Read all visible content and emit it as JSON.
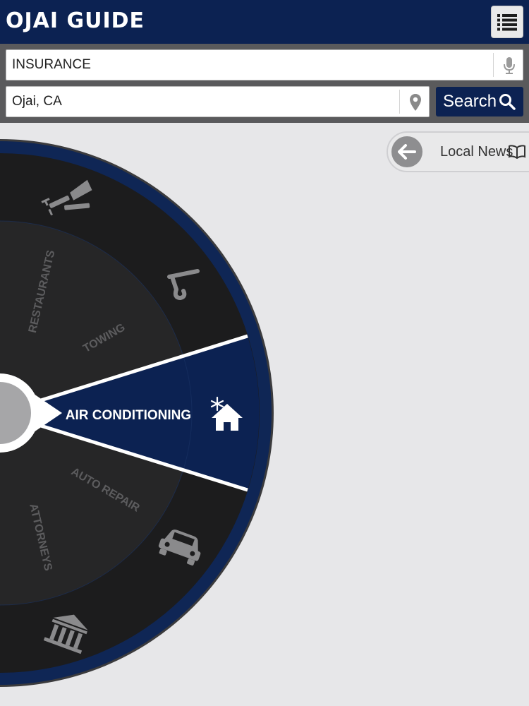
{
  "header": {
    "title": "OJAI GUIDE",
    "menu_icon": "list-icon"
  },
  "search": {
    "keyword_value": "INSURANCE",
    "location_value": "Ojai, CA",
    "button_label": "Search"
  },
  "news": {
    "label": "Local News"
  },
  "wheel": {
    "selected": "AIR CONDITIONING",
    "categories": [
      "RESTAURANTS",
      "TOWING",
      "AUTO REPAIR",
      "ATTORNEYS"
    ]
  },
  "colors": {
    "brand_navy": "#0c2252",
    "wheel_dark": "#1c1c1d",
    "wheel_inner": "#262627",
    "panel_gray": "#5a5a5c",
    "background": "#e7e7e9"
  }
}
